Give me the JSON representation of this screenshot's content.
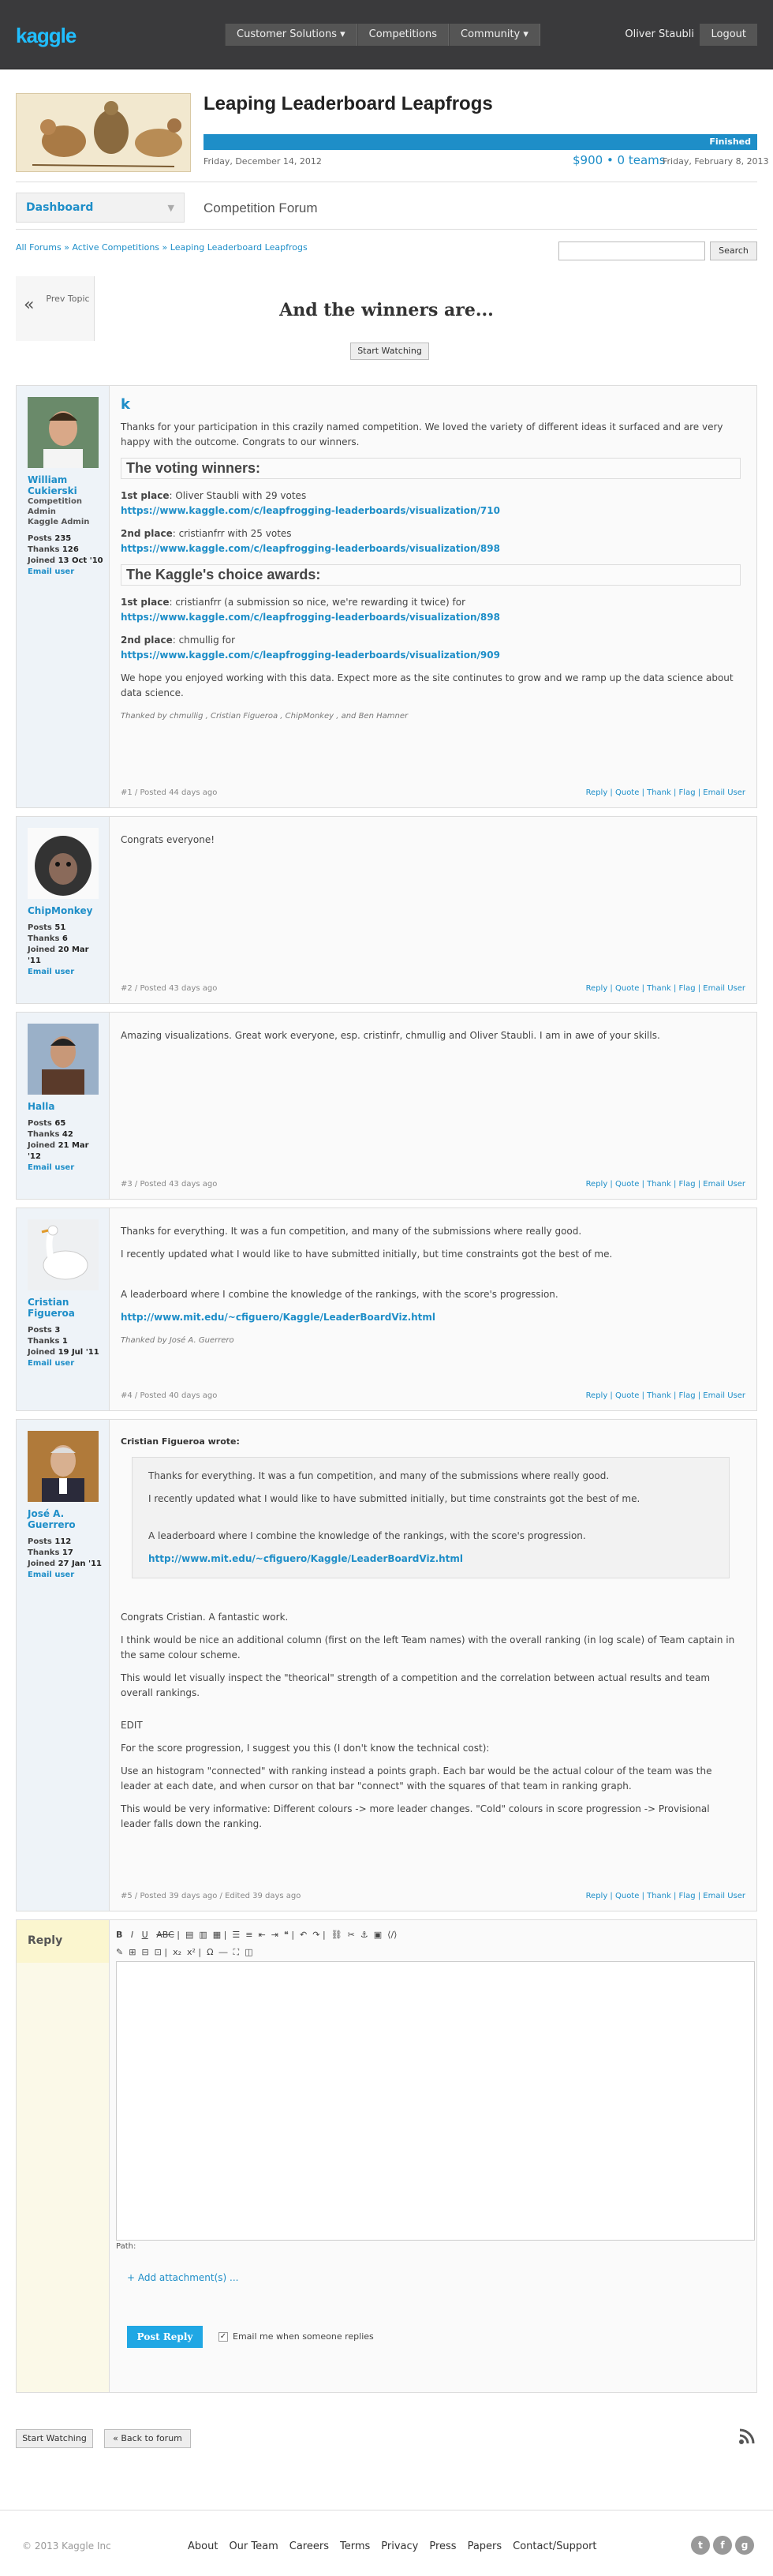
{
  "header": {
    "logo": "kaggle",
    "nav": [
      "Customer Solutions ▾",
      "Competitions",
      "Community ▾"
    ],
    "user": "Oliver Staubli",
    "logout": "Logout"
  },
  "competition": {
    "title": "Leaping Leaderboard Leapfrogs",
    "status": "Finished",
    "progress_pct": 100,
    "start_date": "Friday, December 14, 2012",
    "prize": "$900 • 0 teams",
    "end_date": "Friday, February 8, 2013"
  },
  "sidebar": {
    "dashboard": "Dashboard"
  },
  "forum": {
    "title": "Competition Forum",
    "breadcrumb": "All Forums » Active Competitions » Leaping Leaderboard Leapfrogs",
    "search_button": "Search",
    "prev_topic": "Prev Topic",
    "thread_title": "And the winners are...",
    "start_watching": "Start Watching"
  },
  "posts": [
    {
      "author": "William Cukierski",
      "role1": "Competition Admin",
      "role2": "Kaggle Admin",
      "posts": "235",
      "thanks": "126",
      "joined": "13 Oct '10",
      "email": "Email user",
      "heading": "k",
      "intro": "Thanks for your participation in this crazily named competition. We loved the variety of different ideas it surfaced and are very happy with the outcome. Congrats to our winners.",
      "h_voting": "The voting winners:",
      "v1_label": "1st place",
      "v1_text": ": Oliver Staubli with 29 votes",
      "v1_link": "https://www.kaggle.com/c/leapfrogging-leaderboards/visualization/710",
      "v2_label": "2nd place",
      "v2_text": ": cristianfrr with 25 votes",
      "v2_link": "https://www.kaggle.com/c/leapfrogging-leaderboards/visualization/898",
      "h_choice": "The Kaggle's choice awards:",
      "c1_label": "1st place",
      "c1_text": ": cristianfrr (a submission so nice, we're rewarding it twice) for",
      "c1_link": "https://www.kaggle.com/c/leapfrogging-leaderboards/visualization/898",
      "c2_label": "2nd place",
      "c2_text": ": chmullig for",
      "c2_link": "https://www.kaggle.com/c/leapfrogging-leaderboards/visualization/909",
      "outro": "We hope you enjoyed working with this data.  Expect more as the site continutes to grow and we ramp up the data science about data science.",
      "thanked_by": "Thanked by chmullig , Cristian Figueroa , ChipMonkey , and Ben Hamner",
      "meta": "#1 / Posted 44 days ago"
    },
    {
      "author": "ChipMonkey",
      "posts": "51",
      "thanks": "6",
      "joined": "20 Mar '11",
      "email": "Email user",
      "text": "Congrats everyone!",
      "meta": "#2 / Posted 43 days ago"
    },
    {
      "author": "Halla",
      "posts": "65",
      "thanks": "42",
      "joined": "21 Mar '12",
      "email": "Email user",
      "text": "Amazing visualizations. Great work everyone, esp. cristinfr, chmullig and Oliver Staubli. I am in awe of your skills.",
      "meta": "#3 / Posted 43 days ago"
    },
    {
      "author": "Cristian Figueroa",
      "posts": "3",
      "thanks": "1",
      "joined": "19 Jul '11",
      "email": "Email user",
      "p1": "Thanks for everything. It was a fun competition, and many of the submissions where really good.",
      "p2": "I recently updated what I would like to have submitted initially, but time constraints got the best of me.",
      "p3": "A leaderboard where I combine the knowledge of the rankings, with the score's progression.",
      "link": "http://www.mit.edu/~cfiguero/Kaggle/LeaderBoardViz.html",
      "thanked_by": "Thanked by José A. Guerrero",
      "meta": "#4 / Posted 40 days ago"
    },
    {
      "author": "José A. Guerrero",
      "posts": "112",
      "thanks": "17",
      "joined": "27 Jan '11",
      "email": "Email user",
      "quote_head": "Cristian Figueroa wrote:",
      "q1": "Thanks for everything. It was a fun competition, and many of the submissions where really good.",
      "q2": "I recently updated what I would like to have submitted initially, but time constraints got the best of me.",
      "q3": "A leaderboard where I combine the knowledge of the rankings, with the score's progression.",
      "qlink": "http://www.mit.edu/~cfiguero/Kaggle/LeaderBoardViz.html",
      "p1": "Congrats Cristian. A fantastic work.",
      "p2": "I think would be nice an additional column (first on the left Team names) with the overall ranking (in log scale) of Team captain in the same colour scheme.",
      "p3": "This would let visually inspect the \"theorical\" strength of a competition and the correlation between actual results and team overall rankings.",
      "p4": "EDIT",
      "p5": "For the score progression, I suggest you this (I don't know the technical cost):",
      "p6": "Use an histogram \"connected\" with ranking instead a points graph. Each bar would be the actual colour of the team was the leader at each date, and when cursor on that bar \"connect\" with the squares of that team in ranking graph.",
      "p7": "This would be very informative: Different colours -> more leader changes. \"Cold\" colours in score progression -> Provisional leader falls down the ranking.",
      "meta": "#5 / Posted 39 days ago / Edited 39 days ago"
    }
  ],
  "post_actions": "Reply  |  Quote  |  Thank  |  Flag  |  Email User",
  "stat_labels": {
    "posts": "Posts",
    "thanks": "Thanks",
    "joined": "Joined"
  },
  "reply": {
    "label": "Reply",
    "path": "Path:",
    "attach": "+ Add attachment(s) ...",
    "post_button": "Post Reply",
    "email_me": "Email me when someone replies"
  },
  "bottom": {
    "start_watching": "Start Watching",
    "back": "« Back to forum"
  },
  "footer": {
    "copyright": "© 2013 Kaggle Inc",
    "links": [
      "About",
      "Our Team",
      "Careers",
      "Terms",
      "Privacy",
      "Press",
      "Papers",
      "Contact/Support"
    ]
  }
}
